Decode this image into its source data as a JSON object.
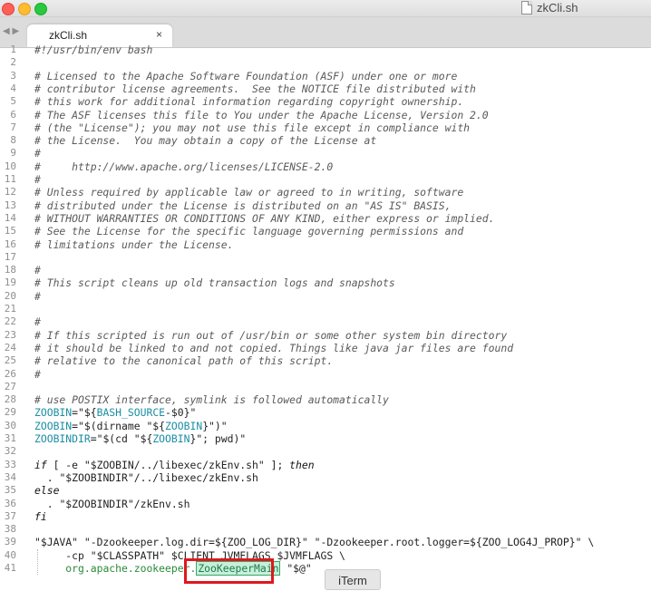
{
  "window": {
    "title": "zkCli.sh"
  },
  "tab_nav": {
    "label": "◀ ▶"
  },
  "tab": {
    "label": "zkCli.sh",
    "close": "×"
  },
  "tooltip": {
    "label": "iTerm"
  },
  "lines": [
    {
      "n": "1",
      "segs": [
        {
          "t": "#!/usr/bin/env bash",
          "c": "cm"
        }
      ]
    },
    {
      "n": "2",
      "segs": []
    },
    {
      "n": "3",
      "segs": [
        {
          "t": "# Licensed to the Apache Software Foundation (ASF) under one or more",
          "c": "cm"
        }
      ]
    },
    {
      "n": "4",
      "segs": [
        {
          "t": "# contributor license agreements.  See the NOTICE file distributed with",
          "c": "cm"
        }
      ]
    },
    {
      "n": "5",
      "segs": [
        {
          "t": "# this work for additional information regarding copyright ownership.",
          "c": "cm"
        }
      ]
    },
    {
      "n": "6",
      "segs": [
        {
          "t": "# The ASF licenses this file to You under the Apache License, Version 2.0",
          "c": "cm"
        }
      ]
    },
    {
      "n": "7",
      "segs": [
        {
          "t": "# (the \"License\"); you may not use this file except in compliance with",
          "c": "cm"
        }
      ]
    },
    {
      "n": "8",
      "segs": [
        {
          "t": "# the License.  You may obtain a copy of the License at",
          "c": "cm"
        }
      ]
    },
    {
      "n": "9",
      "segs": [
        {
          "t": "#",
          "c": "cm"
        }
      ]
    },
    {
      "n": "10",
      "segs": [
        {
          "t": "#     http://www.apache.org/licenses/LICENSE-2.0",
          "c": "cm"
        }
      ]
    },
    {
      "n": "11",
      "segs": [
        {
          "t": "#",
          "c": "cm"
        }
      ]
    },
    {
      "n": "12",
      "segs": [
        {
          "t": "# Unless required by applicable law or agreed to in writing, software",
          "c": "cm"
        }
      ]
    },
    {
      "n": "13",
      "segs": [
        {
          "t": "# distributed under the License is distributed on an \"AS IS\" BASIS,",
          "c": "cm"
        }
      ]
    },
    {
      "n": "14",
      "segs": [
        {
          "t": "# WITHOUT WARRANTIES OR CONDITIONS OF ANY KIND, either express or implied.",
          "c": "cm"
        }
      ]
    },
    {
      "n": "15",
      "segs": [
        {
          "t": "# See the License for the specific language governing permissions and",
          "c": "cm"
        }
      ]
    },
    {
      "n": "16",
      "segs": [
        {
          "t": "# limitations under the License.",
          "c": "cm"
        }
      ]
    },
    {
      "n": "17",
      "segs": []
    },
    {
      "n": "18",
      "segs": [
        {
          "t": "#",
          "c": "cm"
        }
      ]
    },
    {
      "n": "19",
      "segs": [
        {
          "t": "# This script cleans up old transaction logs and snapshots",
          "c": "cm"
        }
      ]
    },
    {
      "n": "20",
      "segs": [
        {
          "t": "#",
          "c": "cm"
        }
      ]
    },
    {
      "n": "21",
      "segs": []
    },
    {
      "n": "22",
      "segs": [
        {
          "t": "#",
          "c": "cm"
        }
      ]
    },
    {
      "n": "23",
      "segs": [
        {
          "t": "# If this scripted is run out of /usr/bin or some other system bin directory",
          "c": "cm"
        }
      ]
    },
    {
      "n": "24",
      "segs": [
        {
          "t": "# it should be linked to and not copied. Things like java jar files are found",
          "c": "cm"
        }
      ]
    },
    {
      "n": "25",
      "segs": [
        {
          "t": "# relative to the canonical path of this script.",
          "c": "cm"
        }
      ]
    },
    {
      "n": "26",
      "segs": [
        {
          "t": "#",
          "c": "cm"
        }
      ]
    },
    {
      "n": "27",
      "segs": []
    },
    {
      "n": "28",
      "segs": [
        {
          "t": "# use POSTIX interface, symlink is followed automatically",
          "c": "cm"
        }
      ]
    },
    {
      "n": "29",
      "segs": [
        {
          "t": "ZOOBIN",
          "c": "var"
        },
        {
          "t": "=\"${",
          "c": "str"
        },
        {
          "t": "BASH_SOURCE",
          "c": "var"
        },
        {
          "t": "-$0}\"",
          "c": "str"
        }
      ]
    },
    {
      "n": "30",
      "segs": [
        {
          "t": "ZOOBIN",
          "c": "var"
        },
        {
          "t": "=\"$(dirname \"${",
          "c": "str"
        },
        {
          "t": "ZOOBIN",
          "c": "var"
        },
        {
          "t": "}\")\"",
          "c": "str"
        }
      ]
    },
    {
      "n": "31",
      "segs": [
        {
          "t": "ZOOBINDIR",
          "c": "var"
        },
        {
          "t": "=\"$(cd \"${",
          "c": "str"
        },
        {
          "t": "ZOOBIN",
          "c": "var"
        },
        {
          "t": "}\"; pwd)\"",
          "c": "str"
        }
      ]
    },
    {
      "n": "32",
      "segs": []
    },
    {
      "n": "33",
      "segs": [
        {
          "t": "if",
          "c": "kw"
        },
        {
          "t": " [ -e \"$ZOOBIN/../libexec/zkEnv.sh\" ]; ",
          "c": "str"
        },
        {
          "t": "then",
          "c": "kw"
        }
      ]
    },
    {
      "n": "34",
      "segs": [
        {
          "t": "  . ",
          "c": "str"
        },
        {
          "t": "\"$ZOOBINDIR\"/../libexec/zkEnv.sh",
          "c": "str"
        }
      ]
    },
    {
      "n": "35",
      "segs": [
        {
          "t": "else",
          "c": "kw"
        }
      ]
    },
    {
      "n": "36",
      "segs": [
        {
          "t": "  . ",
          "c": "str"
        },
        {
          "t": "\"$ZOOBINDIR\"/zkEnv.sh",
          "c": "str"
        }
      ]
    },
    {
      "n": "37",
      "segs": [
        {
          "t": "fi",
          "c": "kw"
        }
      ]
    },
    {
      "n": "38",
      "segs": []
    },
    {
      "n": "39",
      "segs": [
        {
          "t": "\"$JAVA\" \"-Dzookeeper.log.dir=${ZOO_LOG_DIR}\" \"-Dzookeeper.root.logger=${ZOO_LOG4J_PROP}\" \\",
          "c": "str"
        }
      ]
    },
    {
      "n": "40",
      "segs": [
        {
          "t": "     -cp \"$CLASSPATH\" $CLIENT_JVMFLAGS $JVMFLAGS \\",
          "c": "str"
        }
      ]
    },
    {
      "n": "41",
      "segs": [
        {
          "t": "     ",
          "c": "str"
        },
        {
          "t": "org.apache.zookeeper.",
          "c": "grn"
        },
        {
          "t": "ZooKeeperMain",
          "c": "sel"
        },
        {
          "t": " \"$@\"",
          "c": "str"
        }
      ]
    }
  ]
}
